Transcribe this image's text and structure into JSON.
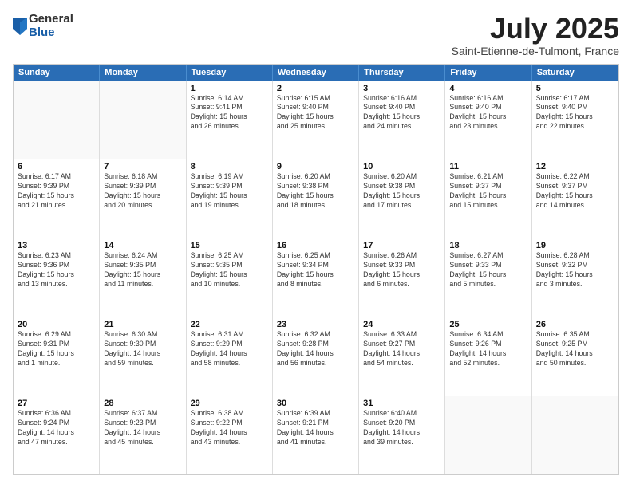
{
  "logo": {
    "general": "General",
    "blue": "Blue"
  },
  "header": {
    "title": "July 2025",
    "subtitle": "Saint-Etienne-de-Tulmont, France"
  },
  "days": [
    "Sunday",
    "Monday",
    "Tuesday",
    "Wednesday",
    "Thursday",
    "Friday",
    "Saturday"
  ],
  "weeks": [
    [
      {
        "day": "",
        "detail": ""
      },
      {
        "day": "",
        "detail": ""
      },
      {
        "day": "1",
        "detail": "Sunrise: 6:14 AM\nSunset: 9:41 PM\nDaylight: 15 hours\nand 26 minutes."
      },
      {
        "day": "2",
        "detail": "Sunrise: 6:15 AM\nSunset: 9:40 PM\nDaylight: 15 hours\nand 25 minutes."
      },
      {
        "day": "3",
        "detail": "Sunrise: 6:16 AM\nSunset: 9:40 PM\nDaylight: 15 hours\nand 24 minutes."
      },
      {
        "day": "4",
        "detail": "Sunrise: 6:16 AM\nSunset: 9:40 PM\nDaylight: 15 hours\nand 23 minutes."
      },
      {
        "day": "5",
        "detail": "Sunrise: 6:17 AM\nSunset: 9:40 PM\nDaylight: 15 hours\nand 22 minutes."
      }
    ],
    [
      {
        "day": "6",
        "detail": "Sunrise: 6:17 AM\nSunset: 9:39 PM\nDaylight: 15 hours\nand 21 minutes."
      },
      {
        "day": "7",
        "detail": "Sunrise: 6:18 AM\nSunset: 9:39 PM\nDaylight: 15 hours\nand 20 minutes."
      },
      {
        "day": "8",
        "detail": "Sunrise: 6:19 AM\nSunset: 9:39 PM\nDaylight: 15 hours\nand 19 minutes."
      },
      {
        "day": "9",
        "detail": "Sunrise: 6:20 AM\nSunset: 9:38 PM\nDaylight: 15 hours\nand 18 minutes."
      },
      {
        "day": "10",
        "detail": "Sunrise: 6:20 AM\nSunset: 9:38 PM\nDaylight: 15 hours\nand 17 minutes."
      },
      {
        "day": "11",
        "detail": "Sunrise: 6:21 AM\nSunset: 9:37 PM\nDaylight: 15 hours\nand 15 minutes."
      },
      {
        "day": "12",
        "detail": "Sunrise: 6:22 AM\nSunset: 9:37 PM\nDaylight: 15 hours\nand 14 minutes."
      }
    ],
    [
      {
        "day": "13",
        "detail": "Sunrise: 6:23 AM\nSunset: 9:36 PM\nDaylight: 15 hours\nand 13 minutes."
      },
      {
        "day": "14",
        "detail": "Sunrise: 6:24 AM\nSunset: 9:35 PM\nDaylight: 15 hours\nand 11 minutes."
      },
      {
        "day": "15",
        "detail": "Sunrise: 6:25 AM\nSunset: 9:35 PM\nDaylight: 15 hours\nand 10 minutes."
      },
      {
        "day": "16",
        "detail": "Sunrise: 6:25 AM\nSunset: 9:34 PM\nDaylight: 15 hours\nand 8 minutes."
      },
      {
        "day": "17",
        "detail": "Sunrise: 6:26 AM\nSunset: 9:33 PM\nDaylight: 15 hours\nand 6 minutes."
      },
      {
        "day": "18",
        "detail": "Sunrise: 6:27 AM\nSunset: 9:33 PM\nDaylight: 15 hours\nand 5 minutes."
      },
      {
        "day": "19",
        "detail": "Sunrise: 6:28 AM\nSunset: 9:32 PM\nDaylight: 15 hours\nand 3 minutes."
      }
    ],
    [
      {
        "day": "20",
        "detail": "Sunrise: 6:29 AM\nSunset: 9:31 PM\nDaylight: 15 hours\nand 1 minute."
      },
      {
        "day": "21",
        "detail": "Sunrise: 6:30 AM\nSunset: 9:30 PM\nDaylight: 14 hours\nand 59 minutes."
      },
      {
        "day": "22",
        "detail": "Sunrise: 6:31 AM\nSunset: 9:29 PM\nDaylight: 14 hours\nand 58 minutes."
      },
      {
        "day": "23",
        "detail": "Sunrise: 6:32 AM\nSunset: 9:28 PM\nDaylight: 14 hours\nand 56 minutes."
      },
      {
        "day": "24",
        "detail": "Sunrise: 6:33 AM\nSunset: 9:27 PM\nDaylight: 14 hours\nand 54 minutes."
      },
      {
        "day": "25",
        "detail": "Sunrise: 6:34 AM\nSunset: 9:26 PM\nDaylight: 14 hours\nand 52 minutes."
      },
      {
        "day": "26",
        "detail": "Sunrise: 6:35 AM\nSunset: 9:25 PM\nDaylight: 14 hours\nand 50 minutes."
      }
    ],
    [
      {
        "day": "27",
        "detail": "Sunrise: 6:36 AM\nSunset: 9:24 PM\nDaylight: 14 hours\nand 47 minutes."
      },
      {
        "day": "28",
        "detail": "Sunrise: 6:37 AM\nSunset: 9:23 PM\nDaylight: 14 hours\nand 45 minutes."
      },
      {
        "day": "29",
        "detail": "Sunrise: 6:38 AM\nSunset: 9:22 PM\nDaylight: 14 hours\nand 43 minutes."
      },
      {
        "day": "30",
        "detail": "Sunrise: 6:39 AM\nSunset: 9:21 PM\nDaylight: 14 hours\nand 41 minutes."
      },
      {
        "day": "31",
        "detail": "Sunrise: 6:40 AM\nSunset: 9:20 PM\nDaylight: 14 hours\nand 39 minutes."
      },
      {
        "day": "",
        "detail": ""
      },
      {
        "day": "",
        "detail": ""
      }
    ]
  ]
}
